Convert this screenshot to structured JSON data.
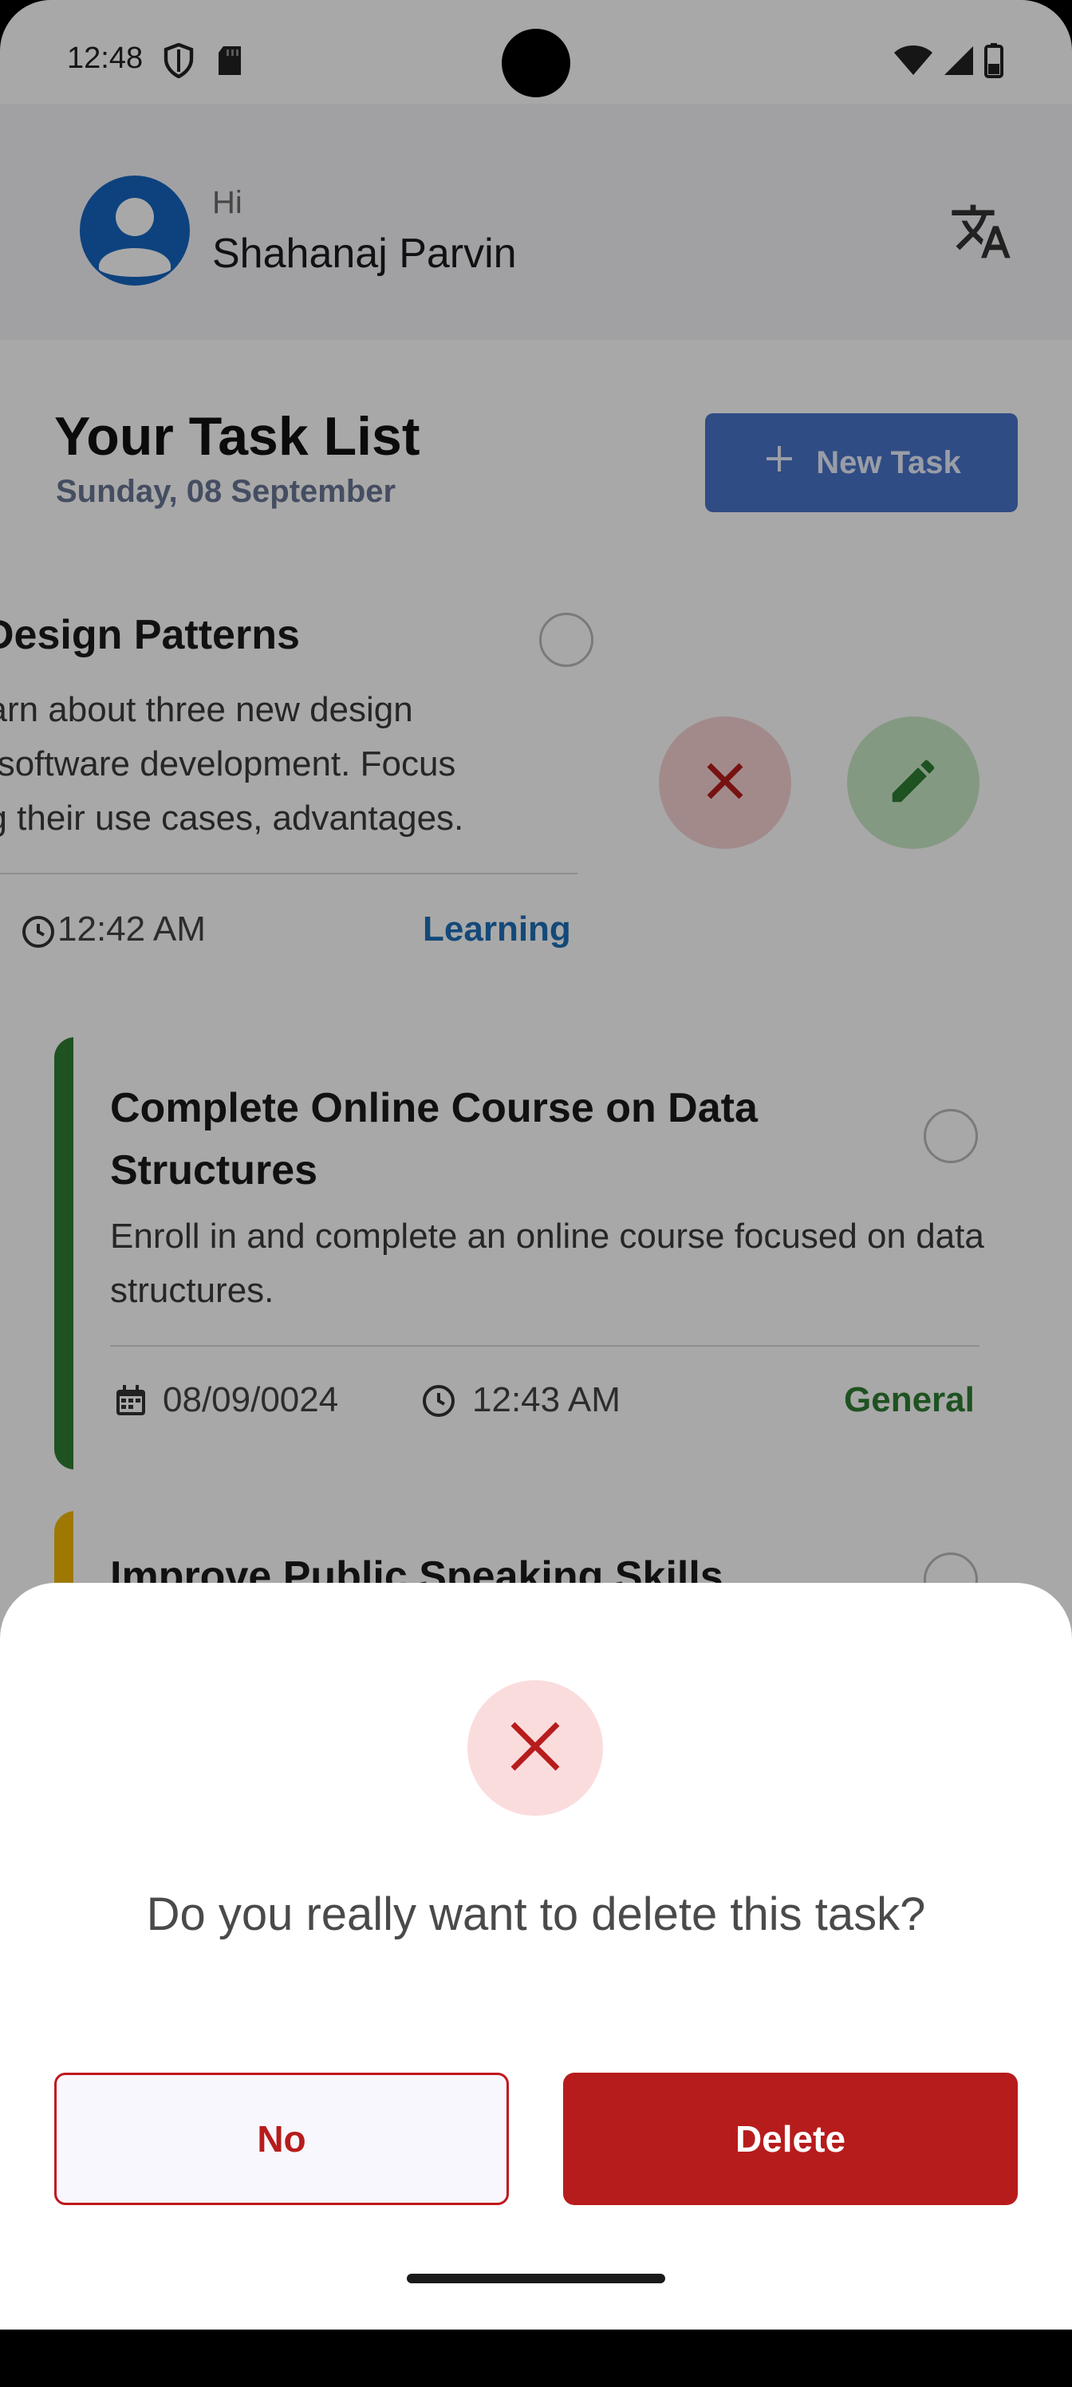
{
  "status_bar": {
    "time": "12:48",
    "icons": [
      "shield-icon",
      "sd-card-icon",
      "wifi-icon",
      "signal-icon",
      "battery-icon"
    ]
  },
  "header": {
    "greeting": "Hi",
    "user_name": "Shahanaj Parvin",
    "avatar_icon": "person-icon",
    "translate_icon": "translate-icon"
  },
  "page": {
    "title": "Your Task List",
    "date": "Sunday, 08 September",
    "new_task_label": "New Task"
  },
  "tasks": [
    {
      "title": "Design Patterns",
      "description": "earn about three new design\nn software development. Focus\nng their use cases, advantages.",
      "time": "12:42 AM",
      "category": "Learning",
      "swiped": true
    },
    {
      "title": "Complete Online Course on Data Structures",
      "description": "Enroll in and complete an online course focused on data structures.",
      "date": "08/09/0024",
      "time": "12:43 AM",
      "category": "General"
    },
    {
      "title": "Improve Public Speaking Skills"
    }
  ],
  "dialog": {
    "message": "Do you really want to delete this task?",
    "no_label": "No",
    "delete_label": "Delete"
  },
  "colors": {
    "primary": "#4a74c9",
    "danger": "#b71c1c",
    "learning": "#1e6fb8",
    "general": "#2e7d32",
    "warning_stripe": "#f2b705"
  }
}
